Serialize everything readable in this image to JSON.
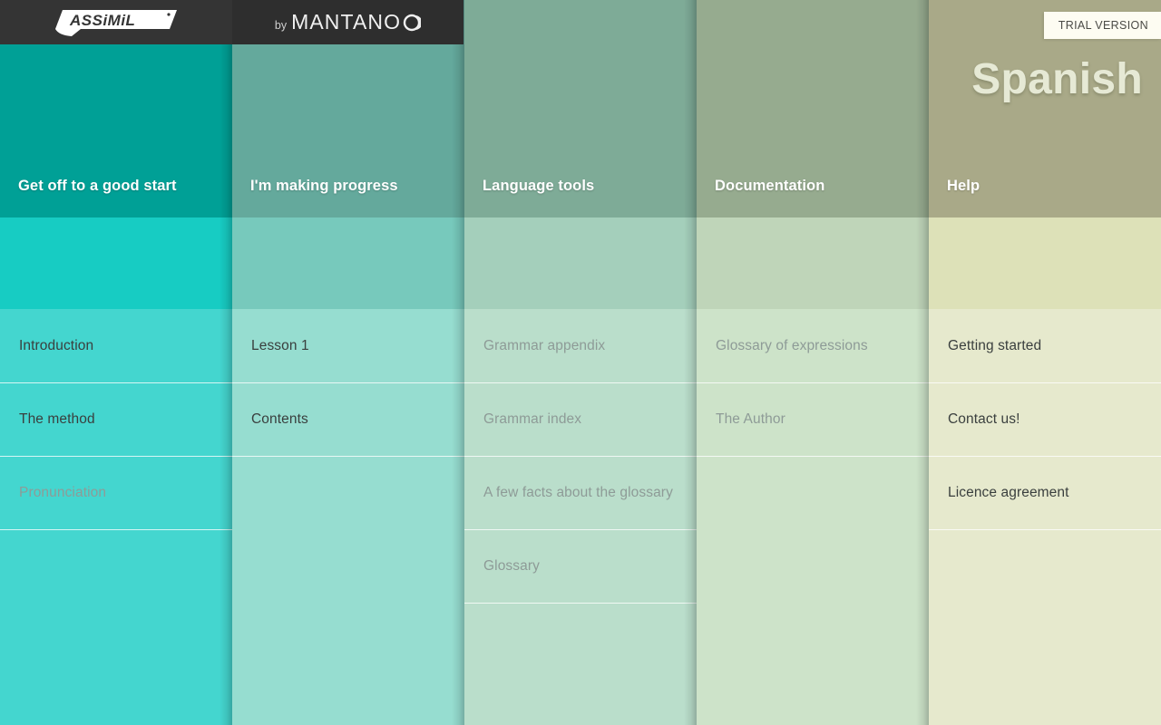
{
  "brand": {
    "logo_name": "ASSIMIL",
    "by_label": "by",
    "partner_name": "MANTANO"
  },
  "header": {
    "language_title": "Spanish",
    "trial_badge": "TRIAL VERSION"
  },
  "colors": {
    "brand_bar_left": "#343434",
    "brand_bar_right": "#2e2e2e",
    "trial_badge_bg": "#fdfcf2",
    "divider": "rgba(255,255,255,0.78)",
    "enabled_text": "#3a3f3e",
    "disabled_text": "#8e9b97"
  },
  "columns": [
    {
      "title": "Get off to a good start",
      "head_color": "#00a096",
      "band_color": "#17ccc3",
      "list_color": "#44d6cf",
      "items": [
        {
          "label": "Introduction",
          "enabled": true
        },
        {
          "label": "The method",
          "enabled": true
        },
        {
          "label": "Pronunciation",
          "enabled": false
        }
      ]
    },
    {
      "title": "I'm making progress",
      "head_color": "#64a99c",
      "band_color": "#77c9bc",
      "list_color": "#96ddd0",
      "items": [
        {
          "label": "Lesson 1",
          "enabled": true
        },
        {
          "label": "Contents",
          "enabled": true
        }
      ]
    },
    {
      "title": "Language tools",
      "head_color": "#7eab97",
      "band_color": "#a4cfbb",
      "list_color": "#badecb",
      "items": [
        {
          "label": "Grammar appendix",
          "enabled": false
        },
        {
          "label": "Grammar index",
          "enabled": false
        },
        {
          "label": "A few facts about the glossary",
          "enabled": false
        },
        {
          "label": "Glossary",
          "enabled": false
        }
      ]
    },
    {
      "title": "Documentation",
      "head_color": "#96ab8f",
      "band_color": "#bfd5b9",
      "list_color": "#cde3c9",
      "items": [
        {
          "label": "Glossary of expressions",
          "enabled": false
        },
        {
          "label": "The Author",
          "enabled": false
        }
      ]
    },
    {
      "title": "Help",
      "head_color": "#a9a988",
      "band_color": "#dde1b8",
      "list_color": "#e6e9cd",
      "items": [
        {
          "label": "Getting started",
          "enabled": true
        },
        {
          "label": "Contact us!",
          "enabled": true
        },
        {
          "label": "Licence agreement",
          "enabled": true
        }
      ]
    }
  ]
}
